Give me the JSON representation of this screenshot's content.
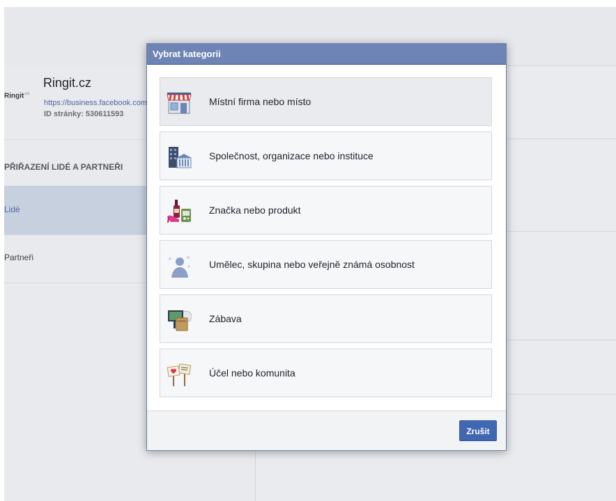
{
  "background_page": {
    "logo_text": "Ringit",
    "logo_suffix": ".cz",
    "page_title": "Ringit.cz",
    "page_url": "https://business.facebook.com",
    "page_id_label": "ID stránky: 530611593",
    "section_header": "PŘIŘAZENÍ LIDÉ A PARTNEŘI",
    "nav_people": "Lidé",
    "nav_partners": "Partneři"
  },
  "dialog": {
    "title": "Vybrat kategorii",
    "categories": [
      {
        "label": "Místní firma nebo místo",
        "icon": "storefront-icon"
      },
      {
        "label": "Společnost, organizace nebo instituce",
        "icon": "building-icon"
      },
      {
        "label": "Značka nebo produkt",
        "icon": "products-icon"
      },
      {
        "label": "Umělec, skupina nebo veřejně známá osobnost",
        "icon": "person-icon"
      },
      {
        "label": "Zábava",
        "icon": "entertainment-icon"
      },
      {
        "label": "Účel nebo komunita",
        "icon": "signs-icon"
      }
    ],
    "cancel_label": "Zrušit"
  },
  "colors": {
    "header_bg": "#6d84b4",
    "button_bg": "#4267b2",
    "overlay_bg": "#e9ebee"
  }
}
